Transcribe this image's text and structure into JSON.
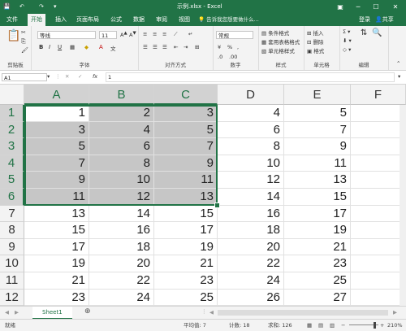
{
  "titlebar": {
    "doc_title": "示例.xlsx - Excel",
    "colors": {
      "bar": "#217346"
    }
  },
  "tabs": {
    "items": [
      "文件",
      "开始",
      "插入",
      "页面布局",
      "公式",
      "数据",
      "审阅",
      "视图"
    ],
    "active": "开始",
    "tell_me": "告诉我您想要做什么...",
    "login": "登录",
    "share": "共享"
  },
  "ribbon": {
    "clipboard": {
      "label": "剪贴板"
    },
    "font": {
      "label": "字体",
      "font_name": "等线",
      "font_size": "11"
    },
    "alignment": {
      "label": "对齐方式"
    },
    "number": {
      "label": "数字",
      "format": "常规"
    },
    "styles": {
      "label": "样式",
      "conditional": "条件格式",
      "table_format": "套用表格格式",
      "cell_styles": "单元格样式"
    },
    "cells": {
      "label": "单元格",
      "insert": "插入",
      "delete": "删除",
      "format": "格式"
    },
    "editing": {
      "label": "编辑"
    }
  },
  "formula_bar": {
    "name_box": "A1",
    "fx": "fx",
    "value": "1"
  },
  "grid": {
    "columns": [
      "A",
      "B",
      "C",
      "D",
      "E",
      "F"
    ],
    "rows": [
      "1",
      "2",
      "3",
      "4",
      "5",
      "6",
      "7",
      "8",
      "9",
      "10",
      "11",
      "12"
    ],
    "selection": {
      "range": "A1:C6",
      "active_cell": "A1",
      "accent": "#217346"
    },
    "data": [
      [
        "1",
        "2",
        "3",
        "4",
        "5",
        ""
      ],
      [
        "3",
        "4",
        "5",
        "6",
        "7",
        ""
      ],
      [
        "5",
        "6",
        "7",
        "8",
        "9",
        ""
      ],
      [
        "7",
        "8",
        "9",
        "10",
        "11",
        ""
      ],
      [
        "9",
        "10",
        "11",
        "12",
        "13",
        ""
      ],
      [
        "11",
        "12",
        "13",
        "14",
        "15",
        ""
      ],
      [
        "13",
        "14",
        "15",
        "16",
        "17",
        ""
      ],
      [
        "15",
        "16",
        "17",
        "18",
        "19",
        ""
      ],
      [
        "17",
        "18",
        "19",
        "20",
        "21",
        ""
      ],
      [
        "19",
        "20",
        "21",
        "22",
        "23",
        ""
      ],
      [
        "21",
        "22",
        "23",
        "24",
        "25",
        ""
      ],
      [
        "23",
        "24",
        "25",
        "26",
        "27",
        ""
      ]
    ]
  },
  "sheets": {
    "tabs": [
      "Sheet1"
    ],
    "active": "Sheet1"
  },
  "status": {
    "state": "就绪",
    "average": "平均值: 7",
    "count": "计数: 18",
    "sum": "求和: 126",
    "zoom": "210%"
  }
}
